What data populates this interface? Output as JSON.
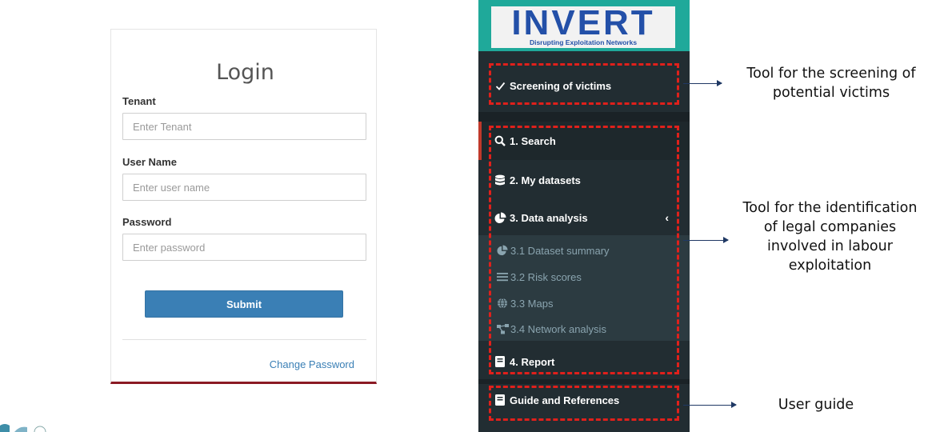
{
  "login": {
    "title": "Login",
    "tenant_label": "Tenant",
    "tenant_placeholder": "Enter Tenant",
    "username_label": "User Name",
    "username_placeholder": "Enter user name",
    "password_label": "Password",
    "password_placeholder": "Enter password",
    "submit_label": "Submit",
    "change_password_label": "Change Password"
  },
  "sidebar": {
    "logo_text": "INVERT",
    "logo_subtitle": "Disrupting Exploitation Networks",
    "screening": {
      "icon": "check-icon",
      "label": "Screening of victims"
    },
    "items": [
      {
        "icon": "search-icon",
        "label": "1. Search"
      },
      {
        "icon": "database-icon",
        "label": "2. My datasets"
      },
      {
        "icon": "pie-chart-icon",
        "label": "3. Data analysis"
      }
    ],
    "subitems": [
      {
        "icon": "pie-chart-icon",
        "label": "3.1 Dataset summary"
      },
      {
        "icon": "list-icon",
        "label": "3.2 Risk scores"
      },
      {
        "icon": "globe-icon",
        "label": "3.3 Maps"
      },
      {
        "icon": "network-icon",
        "label": "3.4 Network analysis"
      }
    ],
    "report": {
      "icon": "book-icon",
      "label": "4. Report"
    },
    "guide": {
      "icon": "book-icon",
      "label": "Guide and References"
    }
  },
  "annotations": {
    "screening_line1": "Tool for the screening of",
    "screening_line2": "potential victims",
    "identification_line1": "Tool for the identification",
    "identification_line2": "of legal companies",
    "identification_line3": "involved in labour",
    "identification_line4": "exploitation",
    "guide": "User guide"
  },
  "colors": {
    "submit_button": "#3a7fb5",
    "sidebar_bg": "#222d32",
    "logo_teal": "#1fa99a",
    "annotation_dash": "#e0201b",
    "card_bottom_border": "#8b1a24"
  }
}
